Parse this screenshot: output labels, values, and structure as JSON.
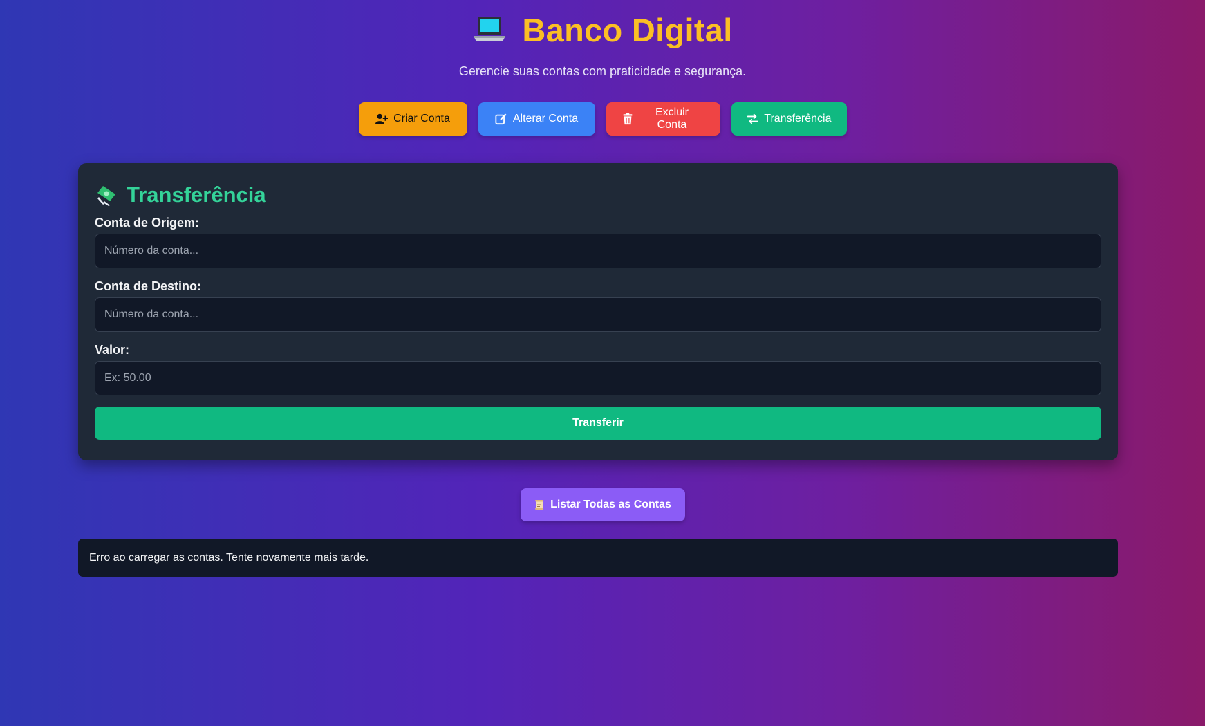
{
  "header": {
    "icon": "laptop-icon",
    "title": "Banco Digital",
    "subtitle": "Gerencie suas contas com praticidade e segurança."
  },
  "actions": {
    "criar": {
      "label": "Criar Conta",
      "icon": "user-plus-icon",
      "color": "#f59e0b"
    },
    "alterar": {
      "label": "Alterar Conta",
      "icon": "edit-icon",
      "color": "#3b82f6"
    },
    "excluir": {
      "label": "Excluir Conta",
      "icon": "trash-icon",
      "color": "#ef4444"
    },
    "transferencia": {
      "label": "Transferência",
      "icon": "exchange-icon",
      "color": "#10b981"
    }
  },
  "form": {
    "title": "Transferência",
    "icon": "money-wings-icon",
    "origem": {
      "label": "Conta de Origem:",
      "placeholder": "Número da conta...",
      "value": ""
    },
    "destino": {
      "label": "Conta de Destino:",
      "placeholder": "Número da conta...",
      "value": ""
    },
    "valor": {
      "label": "Valor:",
      "placeholder": "Ex: 50.00",
      "value": ""
    },
    "submit_label": "Transferir"
  },
  "list": {
    "label": "Listar Todas as Contas",
    "icon": "scroll-icon",
    "color": "#8b5cf6"
  },
  "status": {
    "message": "Erro ao carregar as contas. Tente novamente mais tarde."
  },
  "colors": {
    "title": "#fbbf24",
    "card_title": "#34d399",
    "card_bg": "#1f2937",
    "input_bg": "#111827"
  }
}
